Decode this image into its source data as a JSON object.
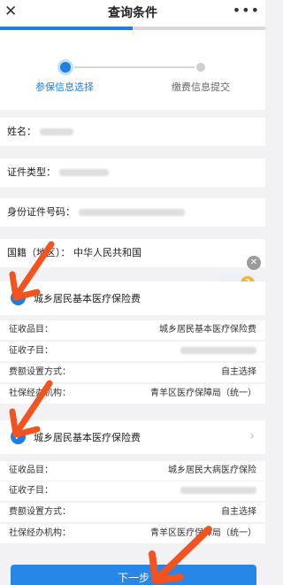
{
  "nav": {
    "title": "查询条件",
    "close_icon": "close-icon",
    "more_icon": "more-icon",
    "progress": 0.5
  },
  "steps": {
    "step1": "参保信息选择",
    "step2": "缴费信息提交"
  },
  "fields": {
    "name_label": "姓名：",
    "id_type_label": "证件类型：",
    "id_number_label": "身份证件号码：",
    "nationality_label": "国籍（地区）：",
    "nationality_value": "中华人民共和国"
  },
  "insurance": [
    {
      "title": "城乡居民基本医疗保险费",
      "item_label": "征收品目：",
      "item_value": "城乡居民基本医疗保险费",
      "sub_label": "征收子目：",
      "fee_label": "费额设置方式：",
      "fee_value": "自主选择",
      "agency_label": "社保经办机构：",
      "agency_value": "青羊区医疗保障局（统一）"
    },
    {
      "title": "城乡居民基本医疗保险费",
      "item_label": "征收品目：",
      "item_value": "城乡居民大病医疗保险",
      "sub_label": "征收子目：",
      "fee_label": "费额设置方式：",
      "fee_value": "自主选择",
      "agency_label": "社保经办机构：",
      "agency_value": "青羊区医疗保障局（统一）"
    }
  ],
  "help": {
    "icon": "help-question-icon",
    "close": "x"
  },
  "next_button": "下一步",
  "colors": {
    "primary": "#1f7fe0",
    "annotation": "#f2531f"
  }
}
